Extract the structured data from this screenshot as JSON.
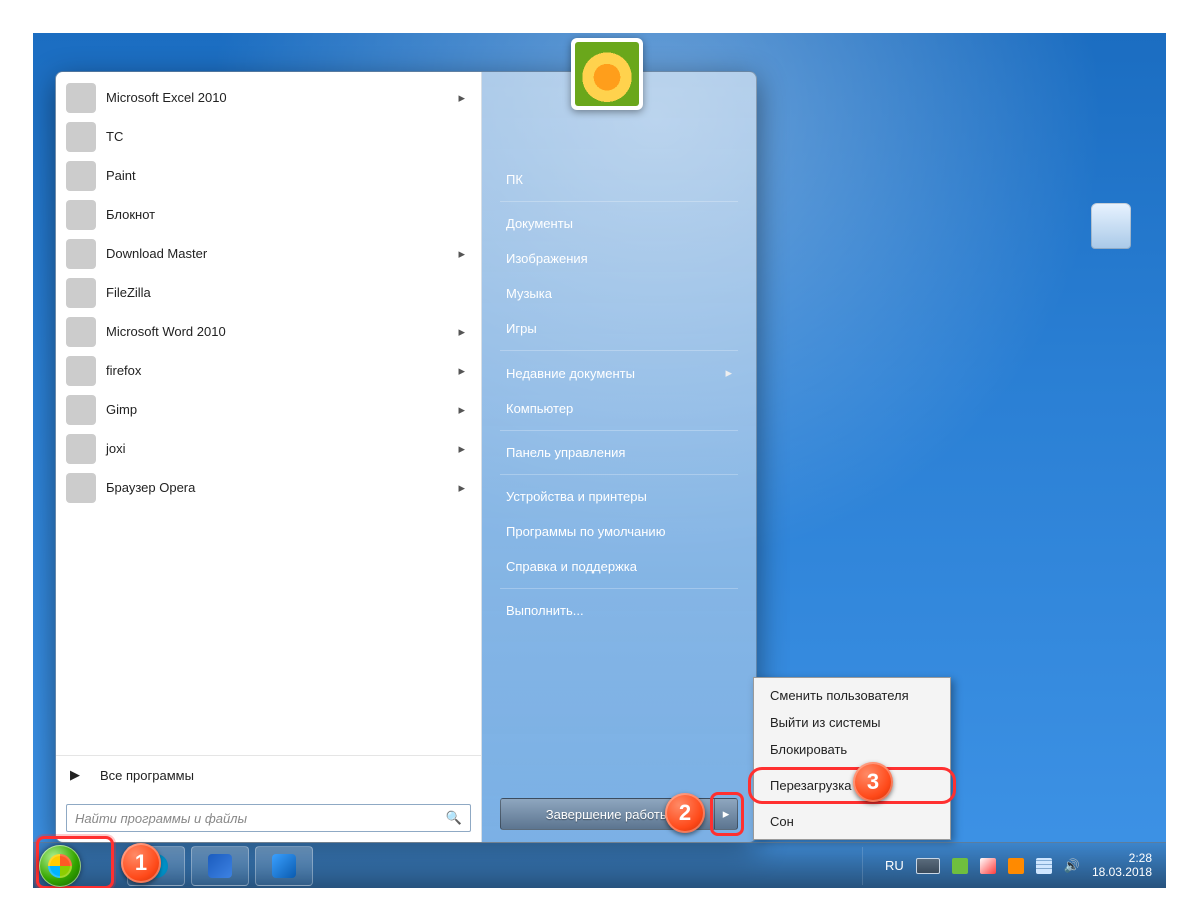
{
  "programs": [
    {
      "label": "Microsoft Excel 2010",
      "icon": "ic-excel",
      "sub": true
    },
    {
      "label": "TC",
      "icon": "ic-tc",
      "sub": false
    },
    {
      "label": "Paint",
      "icon": "ic-paint",
      "sub": false
    },
    {
      "label": "Блокнот",
      "icon": "ic-note",
      "sub": false
    },
    {
      "label": "Download Master",
      "icon": "ic-dm",
      "sub": true
    },
    {
      "label": "FileZilla",
      "icon": "ic-fz",
      "sub": false
    },
    {
      "label": "Microsoft Word 2010",
      "icon": "ic-word",
      "sub": true
    },
    {
      "label": "firefox",
      "icon": "ic-ff",
      "sub": true
    },
    {
      "label": "Gimp",
      "icon": "ic-gimp",
      "sub": true
    },
    {
      "label": "joxi",
      "icon": "ic-joxi",
      "sub": true
    },
    {
      "label": "Браузер Opera",
      "icon": "ic-opera",
      "sub": true
    }
  ],
  "all_programs": "Все программы",
  "search_placeholder": "Найти программы и файлы",
  "right_items": [
    {
      "label": "ПК"
    },
    {
      "label": "Документы"
    },
    {
      "label": "Изображения"
    },
    {
      "label": "Музыка"
    },
    {
      "label": "Игры"
    },
    {
      "label": "Недавние документы",
      "sub": true
    },
    {
      "label": "Компьютер"
    },
    {
      "label": "Панель управления"
    },
    {
      "label": "Устройства и принтеры"
    },
    {
      "label": "Программы по умолчанию"
    },
    {
      "label": "Справка и поддержка"
    },
    {
      "label": "Выполнить..."
    }
  ],
  "shutdown_label": "Завершение работы",
  "power_menu": [
    "Сменить пользователя",
    "Выйти из системы",
    "Блокировать",
    "Перезагрузка",
    "Сон"
  ],
  "tray": {
    "lang": "RU",
    "time": "2:28",
    "date": "18.03.2018"
  },
  "badges": {
    "b1": "1",
    "b2": "2",
    "b3": "3"
  }
}
